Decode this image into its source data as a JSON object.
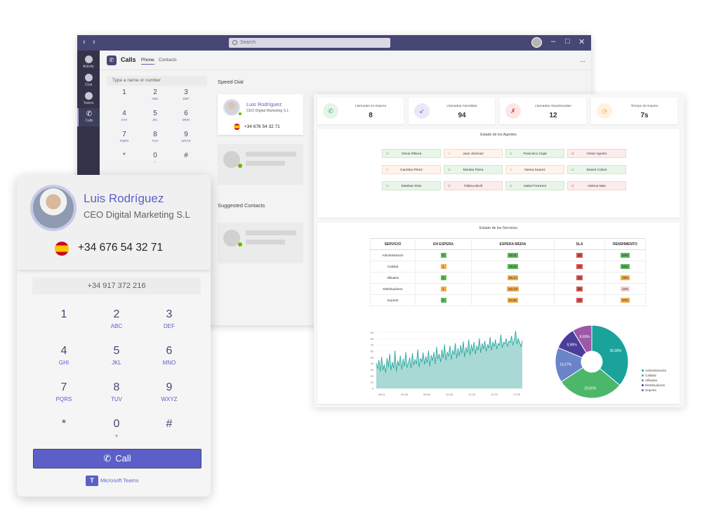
{
  "teams_window": {
    "search_placeholder": "Search",
    "rail": [
      {
        "label": "Activity",
        "icon": "bell-icon"
      },
      {
        "label": "Chat",
        "icon": "chat-icon"
      },
      {
        "label": "Teams",
        "icon": "teams-icon"
      },
      {
        "label": "Calls",
        "icon": "phone-icon"
      }
    ],
    "header": {
      "title": "Calls",
      "tabs": [
        "Phone",
        "Contacts"
      ],
      "more": "..."
    },
    "dial_input_placeholder": "Type a name or number",
    "keys": [
      {
        "n": "1",
        "l": ""
      },
      {
        "n": "2",
        "l": "ABC"
      },
      {
        "n": "3",
        "l": "DEF"
      },
      {
        "n": "4",
        "l": "GHI"
      },
      {
        "n": "5",
        "l": "JKL"
      },
      {
        "n": "6",
        "l": "MNO"
      },
      {
        "n": "7",
        "l": "PQRS"
      },
      {
        "n": "8",
        "l": "TUV"
      },
      {
        "n": "9",
        "l": "WXYZ"
      },
      {
        "n": "*",
        "l": ""
      },
      {
        "n": "0",
        "l": "+"
      },
      {
        "n": "#",
        "l": ""
      }
    ],
    "speed_dial_label": "Speed Dial",
    "suggested_label": "Suggested Contacts",
    "speed_dial_contact": {
      "name": "Luis Rodríguez",
      "role": "CEO Digital Marketing S.L",
      "phone": "+34 676 54 32 71"
    }
  },
  "dashboard": {
    "kpis": [
      {
        "label": "Llamadas en Espera",
        "value": "8",
        "icon": "phone-icon",
        "color": "#e6f4ea",
        "icolor": "#3aa55b"
      },
      {
        "label": "Llamadas Atendidas",
        "value": "94",
        "icon": "phone-in-icon",
        "color": "#e8e8f6",
        "icolor": "#5b5fc7"
      },
      {
        "label": "Llamadas Abandonadas",
        "value": "12",
        "icon": "phone-missed-icon",
        "color": "#fde6e6",
        "icolor": "#d13438"
      },
      {
        "label": "Tiempo de Espera",
        "value": "7s",
        "icon": "clock-icon",
        "color": "#fff1e0",
        "icolor": "#f2994a"
      }
    ],
    "agents_title": "Estado de los Agentes",
    "agents": [
      {
        "name": "Oscar Ribera",
        "status": "g"
      },
      {
        "name": "Juan Jiménez",
        "status": "o"
      },
      {
        "name": "Francisco Cajal",
        "status": "g"
      },
      {
        "name": "Víctor Aguirre",
        "status": "r"
      },
      {
        "name": "Carolina Pérez",
        "status": "o"
      },
      {
        "name": "Montse Parra",
        "status": "g"
      },
      {
        "name": "Nerea Suarez",
        "status": "o"
      },
      {
        "name": "Daniel Cobos",
        "status": "g"
      },
      {
        "name": "Esteban Díaz",
        "status": "g"
      },
      {
        "name": "Fátima Brull",
        "status": "r"
      },
      {
        "name": "Isabel Ferreres",
        "status": "g"
      },
      {
        "name": "Helena Mas",
        "status": "r"
      }
    ],
    "services_title": "Estado de los Servicios",
    "services_headers": [
      "SERVICIO",
      "EN ESPERA",
      "ESPERA MEDIA",
      "SLA",
      "RENDIMIENTO"
    ],
    "services": [
      {
        "name": "Administración",
        "espera": "0",
        "ecol": "#5cb85c",
        "media": "22.11",
        "mcol": "#5cb85c",
        "sla": "30",
        "scol": "#d9534f",
        "rend": "54%",
        "rcol": "#5cb85c"
      },
      {
        "name": "Calidad",
        "espera": "1",
        "ecol": "#f0ad4e",
        "media": "28.22",
        "mcol": "#5cb85c",
        "sla": "30",
        "scol": "#d9534f",
        "rend": "83%",
        "rcol": "#5cb85c"
      },
      {
        "name": "Afiliados",
        "espera": "0",
        "ecol": "#5cb85c",
        "media": "56.14",
        "mcol": "#f0ad4e",
        "sla": "30",
        "scol": "#d9534f",
        "rend": "78%",
        "rcol": "#f0ad4e"
      },
      {
        "name": "Distribuidores",
        "espera": "1",
        "ecol": "#f0ad4e",
        "media": "111.23",
        "mcol": "#f0ad4e",
        "sla": "30",
        "scol": "#d9534f",
        "rend": "12%",
        "rcol": "#f8d0d0"
      },
      {
        "name": "Soporte",
        "espera": "0",
        "ecol": "#5cb85c",
        "media": "84.55",
        "mcol": "#f0ad4e",
        "sla": "30",
        "scol": "#d9534f",
        "rend": "40%",
        "rcol": "#f0ad4e"
      }
    ],
    "area_chart": {
      "y_ticks": [
        "0",
        "10",
        "20",
        "30",
        "40",
        "50",
        "60",
        "70",
        "80",
        "90"
      ],
      "x_ticks": [
        "08:11",
        "09:05",
        "09:45",
        "10:45",
        "11:15",
        "12:15",
        "17:00"
      ],
      "values": [
        40,
        32,
        45,
        28,
        50,
        30,
        38,
        26,
        48,
        35,
        55,
        30,
        42,
        33,
        60,
        28,
        44,
        37,
        52,
        31,
        47,
        36,
        58,
        34,
        41,
        49,
        33,
        56,
        38,
        46,
        40,
        62,
        35,
        48,
        44,
        57,
        39,
        51,
        42,
        60,
        36,
        53,
        45,
        58,
        40,
        66,
        48,
        55,
        43,
        62,
        50,
        70,
        46,
        58,
        52,
        68,
        47,
        61,
        55,
        72,
        49,
        64,
        53,
        69,
        57,
        75,
        51,
        66,
        58,
        78,
        54,
        70,
        60,
        74,
        56,
        68,
        62,
        80,
        58,
        72,
        64,
        76,
        60,
        70,
        66,
        82,
        62,
        74,
        68,
        78,
        64,
        72,
        70,
        86,
        66,
        74,
        72,
        80,
        68,
        76,
        74,
        84,
        70,
        78,
        92,
        72,
        80,
        74,
        68,
        76
      ]
    },
    "pie_chart": {
      "slices": [
        {
          "label": "Administración",
          "value": 36.08,
          "color": "#1aa39a"
        },
        {
          "label": "Calidad",
          "value": 29.6,
          "color": "#4cb76b"
        },
        {
          "label": "Afiliados",
          "value": 15.57,
          "color": "#6b83c9"
        },
        {
          "label": "Distribuidores",
          "value": 9.98,
          "color": "#4b3d9c"
        },
        {
          "label": "Soporte",
          "value": 8.69,
          "color": "#9b5aa8"
        }
      ],
      "labels": [
        "36,08%",
        "29,60%",
        "15,57%",
        "9,98%",
        "8,69%"
      ]
    }
  },
  "floating_card": {
    "name": "Luis Rodríguez",
    "role": "CEO Digital Marketing S.L",
    "phone": "+34 676 54 32 71",
    "dial_input": "+34 917 372 216",
    "call_label": "Call",
    "brand": "Microsoft Teams"
  }
}
